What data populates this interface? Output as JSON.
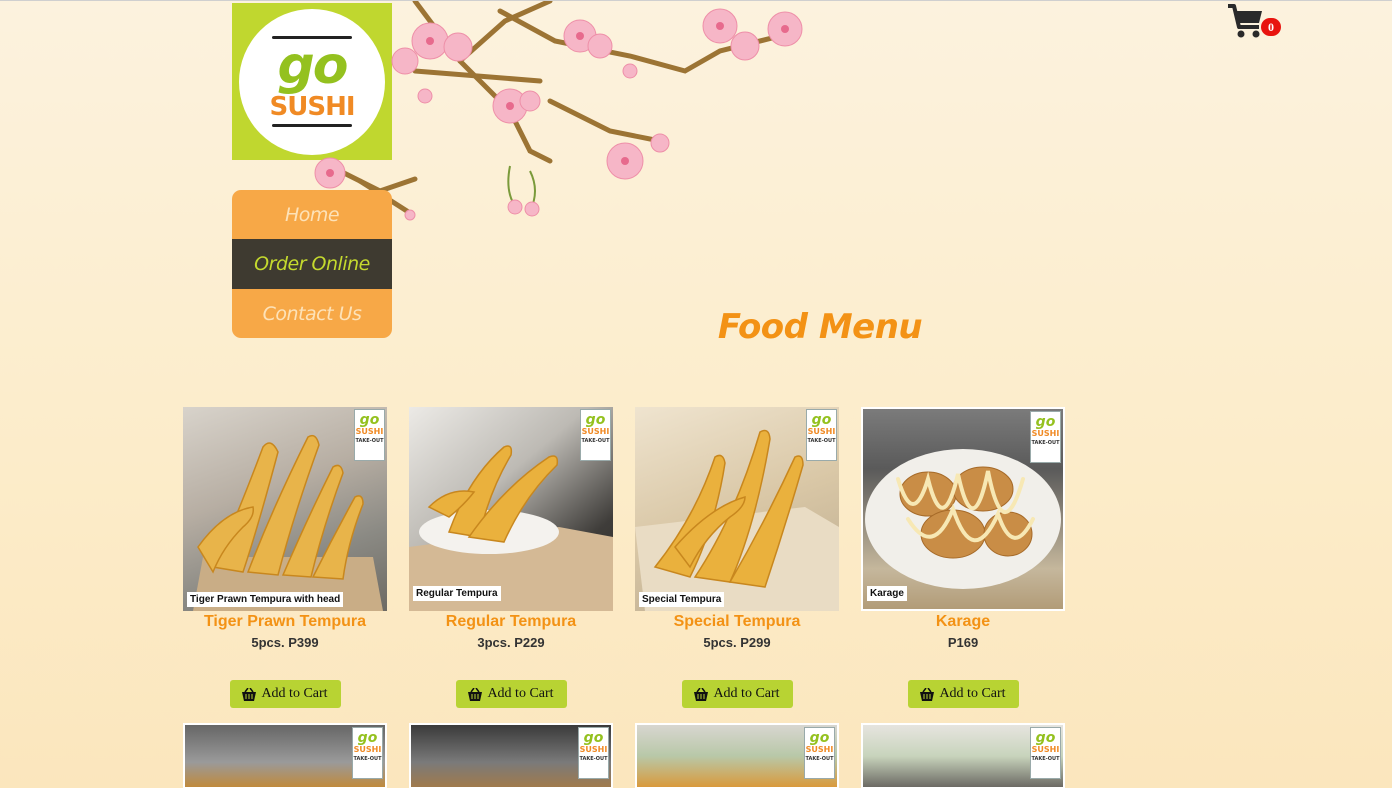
{
  "brand": {
    "logo_top": "go",
    "logo_bottom": "SUSHI"
  },
  "nav": {
    "items": [
      {
        "label": "Home",
        "active": false
      },
      {
        "label": "Order Online",
        "active": true
      },
      {
        "label": "Contact Us",
        "active": false
      }
    ]
  },
  "cart": {
    "icon": "cart-icon",
    "count": "0"
  },
  "page": {
    "title": "Food Menu"
  },
  "menu": {
    "items": [
      {
        "name": "Tiger Prawn Tempura",
        "price": "5pcs. P399",
        "caption": "Tiger Prawn Tempura with head",
        "button": "Add to Cart"
      },
      {
        "name": "Regular Tempura",
        "price": "3pcs. P229",
        "caption": "Regular Tempura",
        "button": "Add to Cart"
      },
      {
        "name": "Special Tempura",
        "price": "5pcs. P299",
        "caption": "Special Tempura",
        "button": "Add to Cart"
      },
      {
        "name": "Karage",
        "price": "P169",
        "caption": "Karage",
        "button": "Add to Cart"
      }
    ],
    "stamp": {
      "go": "go",
      "sushi": "SUSHI",
      "tag": "TAKE-OUT"
    }
  },
  "colors": {
    "accent": "#f39215",
    "nav": "#f7a847",
    "nav_active": "#3e3a30",
    "button": "#b8d333",
    "badge": "#e8140f"
  }
}
